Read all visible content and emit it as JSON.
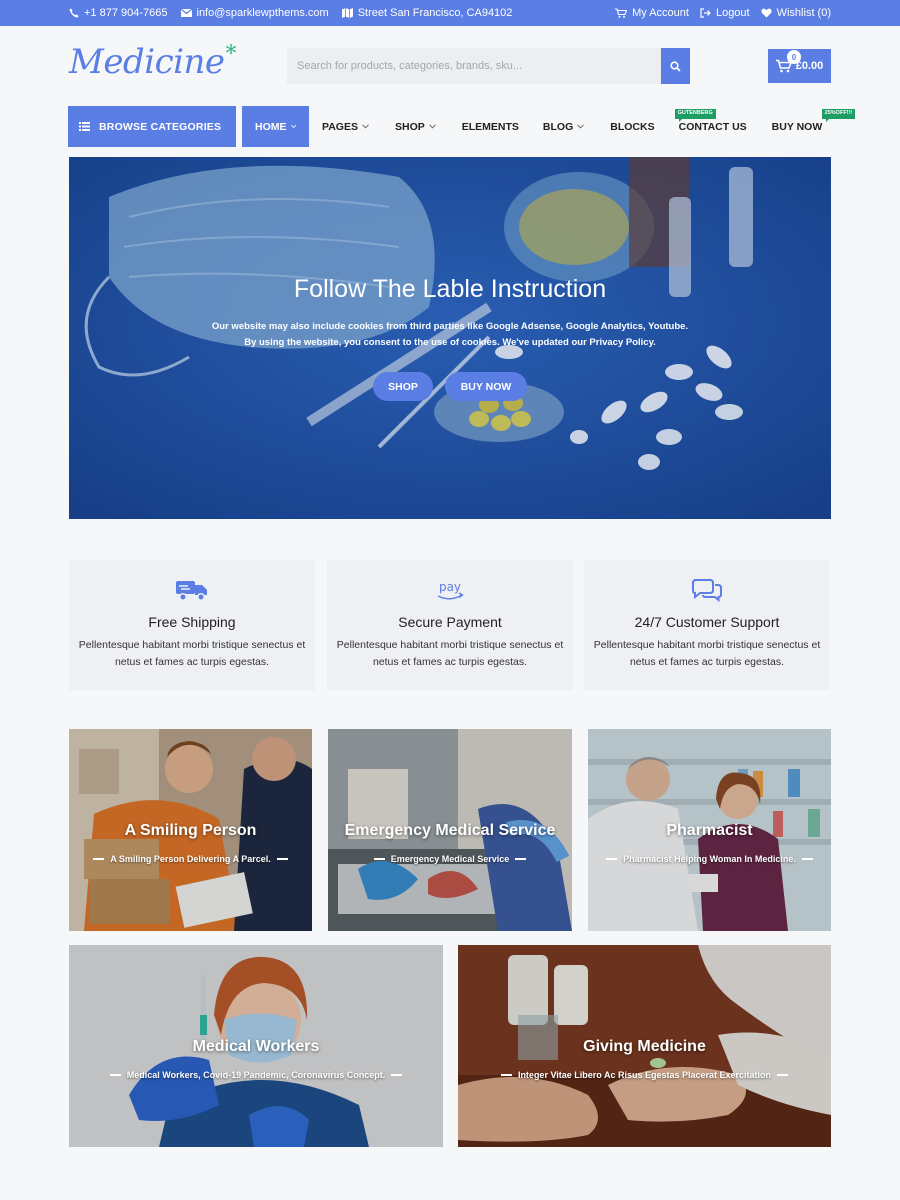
{
  "topbar": {
    "phone": "+1 877 904-7665",
    "email": "info@sparklewpthems.com",
    "address": "Street San Francisco, CA94102",
    "my_account": "My Account",
    "logout": "Logout",
    "wishlist": "Wishlist (0)"
  },
  "header": {
    "logo": "Medicine",
    "logo_mark": "*",
    "search_placeholder": "Search for products, categories, brands, sku...",
    "cart_count": "0",
    "cart_total": "£0.00"
  },
  "nav": {
    "browse_label": "BROWSE CATEGORIES",
    "items": [
      {
        "label": "HOME",
        "dropdown": true,
        "active": true
      },
      {
        "label": "PAGES",
        "dropdown": true
      },
      {
        "label": "SHOP",
        "dropdown": true
      },
      {
        "label": "ELEMENTS",
        "dropdown": false
      },
      {
        "label": "BLOG",
        "dropdown": true
      },
      {
        "label": "BLOCKS",
        "dropdown": false
      },
      {
        "label": "CONTACT US",
        "dropdown": false,
        "badge": "GUTENBERG"
      },
      {
        "label": "BUY NOW",
        "dropdown": false,
        "badge": "25%OFF!!!"
      }
    ]
  },
  "hero": {
    "title": "Follow The Lable Instruction",
    "line1": "Our website may also include cookies from third parties like Google Adsense, Google Analytics, Youtube.",
    "line2": "By using the website, you consent to the use of cookies. We've updated our Privacy Policy.",
    "btn_shop": "SHOP",
    "btn_buy": "BUY NOW"
  },
  "features": [
    {
      "icon": "truck-icon",
      "title": "Free Shipping",
      "text": "Pellentesque habitant morbi tristique senectus et netus et fames ac turpis egestas."
    },
    {
      "icon": "pay-icon",
      "title": "Secure Payment",
      "text": "Pellentesque habitant morbi tristique senectus et netus et fames ac turpis egestas."
    },
    {
      "icon": "chat-icon",
      "title": "24/7 Customer Support",
      "text": "Pellentesque habitant morbi tristique senectus et netus et fames ac turpis egestas."
    }
  ],
  "tiles": [
    {
      "title": "A Smiling Person",
      "subtitle": "A Smiling Person Delivering A Parcel."
    },
    {
      "title": "Emergency Medical Service",
      "subtitle": "Emergency Medical Service"
    },
    {
      "title": "Pharmacist",
      "subtitle": "Pharmacist Helping Woman In Medicine."
    },
    {
      "title": "Medical Workers",
      "subtitle": "Medical Workers, Covid-19 Pandemic, Coronavirus Concept."
    },
    {
      "title": "Giving Medicine",
      "subtitle": "Integer Vitae Libero Ac Risus Egestas Placerat Exercitation"
    }
  ],
  "colors": {
    "accent": "#5b7ee5",
    "badge": "#1e9e64",
    "logo_mark": "#2fb47c"
  }
}
